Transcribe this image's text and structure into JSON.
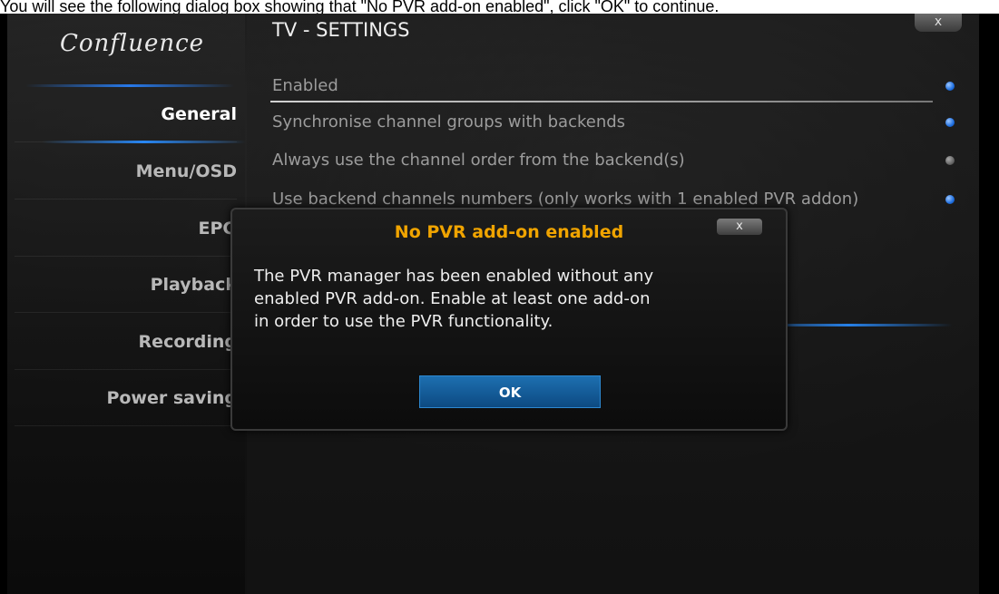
{
  "caption": "You will see the following dialog box showing that \"No PVR add-on enabled\", click \"OK\" to continue.",
  "app": {
    "logo": "Confluence",
    "window_close": "x"
  },
  "sidebar": {
    "items": [
      {
        "label": "General",
        "active": true
      },
      {
        "label": "Menu/OSD",
        "active": false
      },
      {
        "label": "EPG",
        "active": false
      },
      {
        "label": "Playback",
        "active": false
      },
      {
        "label": "Recording",
        "active": false
      },
      {
        "label": "Power saving",
        "active": false
      }
    ]
  },
  "panel": {
    "title": "TV - SETTINGS",
    "settings": [
      {
        "label": "Enabled",
        "state": "on"
      },
      {
        "label": "Synchronise channel groups with backends",
        "state": "on"
      },
      {
        "label": "Always use the channel order from the backend(s)",
        "state": "off"
      },
      {
        "label": "Use backend channels numbers (only works with 1 enabled PVR addon)",
        "state": "on"
      }
    ]
  },
  "dialog": {
    "title": "No PVR add-on enabled",
    "close": "x",
    "lines": [
      "The PVR manager has been enabled without any",
      "enabled PVR add-on. Enable at least one add-on",
      "in order to use the PVR functionality."
    ],
    "ok_label": "OK"
  },
  "colors": {
    "dialog_title": "#f0a400",
    "accent_blue": "#1f6fe0",
    "ok_button": "#1d6fb0"
  }
}
